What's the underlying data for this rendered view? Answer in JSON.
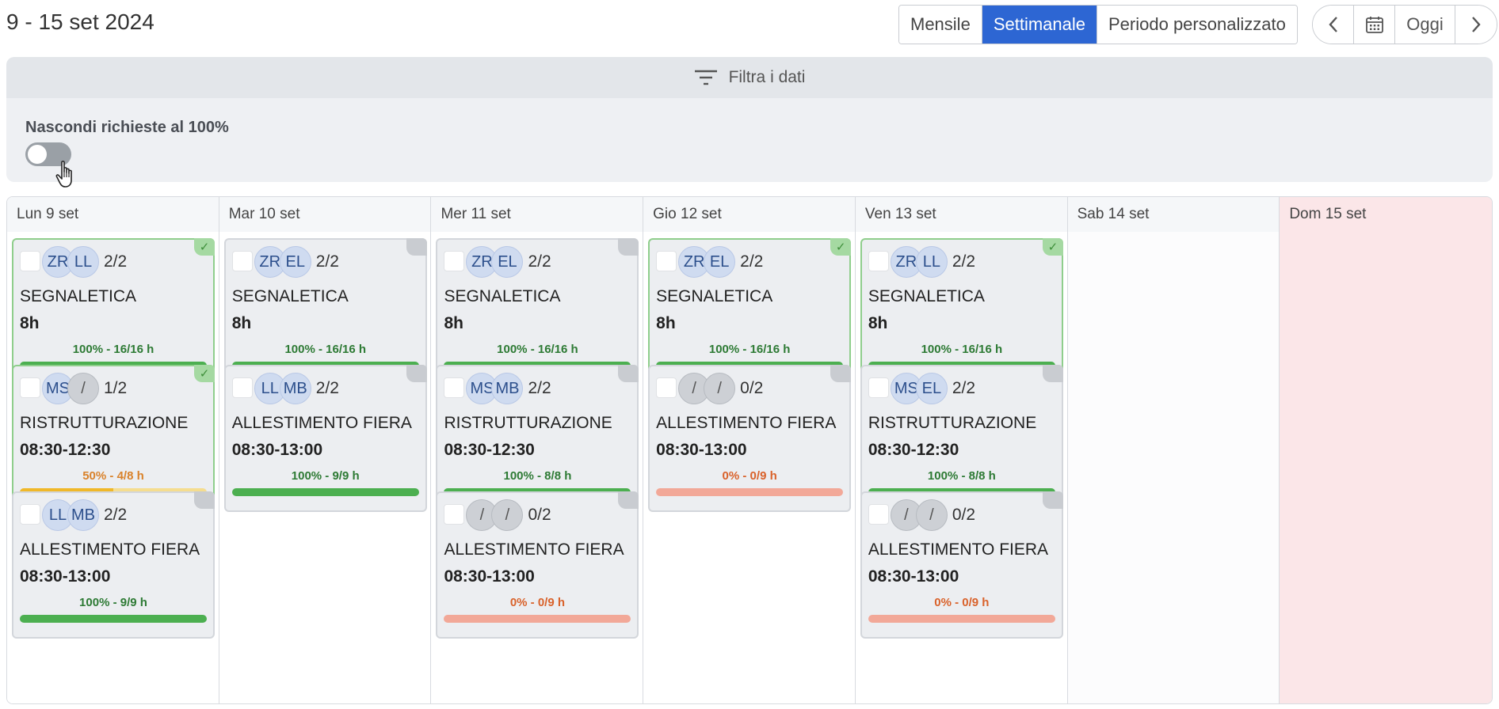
{
  "header": {
    "title": "9 - 15 set 2024",
    "views": [
      "Mensile",
      "Settimanale",
      "Periodo personalizzato"
    ],
    "active_view": "Settimanale",
    "nav": {
      "prev_icon": "‹",
      "calendar_icon": "calendar-icon",
      "today": "Oggi",
      "next_icon": "›"
    }
  },
  "filter": {
    "label": "Filtra i dati",
    "hide_label": "Nascondi richieste al 100%",
    "hide_enabled": false
  },
  "colors": {
    "accent": "#2d66d3",
    "green": "#4caf50",
    "yellow": "#f0b829",
    "red": "#f2a898",
    "sunday": "#fbe6e8"
  },
  "days": [
    {
      "label": "Lun 9 set",
      "cards": [
        {
          "avatars": [
            "ZR",
            "LL"
          ],
          "count": "2/2",
          "title": "SEGNALETICA",
          "time": "8h",
          "progress": "100% - 16/16 h",
          "percent": 100,
          "status": "green",
          "done": true
        },
        {
          "avatars": [
            "MS",
            "/"
          ],
          "count": "1/2",
          "title": "RISTRUTTURAZIONE",
          "time": "08:30-12:30",
          "progress": "50% - 4/8 h",
          "percent": 50,
          "status": "yellow",
          "done": true
        },
        {
          "avatars": [
            "LL",
            "MB"
          ],
          "count": "2/2",
          "title": "ALLESTIMENTO FIERA",
          "time": "08:30-13:00",
          "progress": "100% - 9/9 h",
          "percent": 100,
          "status": "green",
          "done": false
        }
      ]
    },
    {
      "label": "Mar 10 set",
      "cards": [
        {
          "avatars": [
            "ZR",
            "EL"
          ],
          "count": "2/2",
          "title": "SEGNALETICA",
          "time": "8h",
          "progress": "100% - 16/16 h",
          "percent": 100,
          "status": "green",
          "done": false
        },
        {
          "avatars": [
            "LL",
            "MB"
          ],
          "count": "2/2",
          "title": "ALLESTIMENTO FIERA",
          "time": "08:30-13:00",
          "progress": "100% - 9/9 h",
          "percent": 100,
          "status": "green",
          "done": false
        }
      ]
    },
    {
      "label": "Mer 11 set",
      "cards": [
        {
          "avatars": [
            "ZR",
            "EL"
          ],
          "count": "2/2",
          "title": "SEGNALETICA",
          "time": "8h",
          "progress": "100% - 16/16 h",
          "percent": 100,
          "status": "green",
          "done": false
        },
        {
          "avatars": [
            "MS",
            "MB"
          ],
          "count": "2/2",
          "title": "RISTRUTTURAZIONE",
          "time": "08:30-12:30",
          "progress": "100% - 8/8 h",
          "percent": 100,
          "status": "green",
          "done": false
        },
        {
          "avatars": [
            "/",
            "/"
          ],
          "count": "0/2",
          "title": "ALLESTIMENTO FIERA",
          "time": "08:30-13:00",
          "progress": "0% - 0/9 h",
          "percent": 0,
          "status": "red",
          "done": false
        }
      ]
    },
    {
      "label": "Gio 12 set",
      "cards": [
        {
          "avatars": [
            "ZR",
            "EL"
          ],
          "count": "2/2",
          "title": "SEGNALETICA",
          "time": "8h",
          "progress": "100% - 16/16 h",
          "percent": 100,
          "status": "green",
          "done": true
        },
        {
          "avatars": [
            "/",
            "/"
          ],
          "count": "0/2",
          "title": "ALLESTIMENTO FIERA",
          "time": "08:30-13:00",
          "progress": "0% - 0/9 h",
          "percent": 0,
          "status": "red",
          "done": false
        }
      ]
    },
    {
      "label": "Ven 13 set",
      "cards": [
        {
          "avatars": [
            "ZR",
            "LL"
          ],
          "count": "2/2",
          "title": "SEGNALETICA",
          "time": "8h",
          "progress": "100% - 16/16 h",
          "percent": 100,
          "status": "green",
          "done": true
        },
        {
          "avatars": [
            "MS",
            "EL"
          ],
          "count": "2/2",
          "title": "RISTRUTTURAZIONE",
          "time": "08:30-12:30",
          "progress": "100% - 8/8 h",
          "percent": 100,
          "status": "green",
          "done": false
        },
        {
          "avatars": [
            "/",
            "/"
          ],
          "count": "0/2",
          "title": "ALLESTIMENTO FIERA",
          "time": "08:30-13:00",
          "progress": "0% - 0/9 h",
          "percent": 0,
          "status": "red",
          "done": false
        }
      ]
    },
    {
      "label": "Sab 14 set",
      "cards": []
    },
    {
      "label": "Dom 15 set",
      "cards": []
    }
  ]
}
